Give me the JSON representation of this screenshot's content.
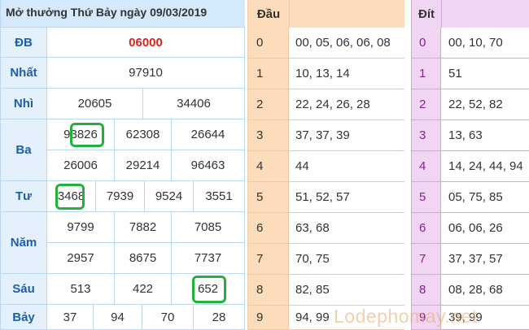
{
  "results": {
    "title": "Mở thưởng Thứ Bảy ngày 09/03/2019",
    "labels": {
      "db": "ĐB",
      "nhat": "Nhất",
      "nhi": "Nhì",
      "ba": "Ba",
      "tu": "Tư",
      "nam": "Năm",
      "sau": "Sáu",
      "bay": "Bảy"
    },
    "db": "06000",
    "nhat": "97910",
    "nhi": [
      "20605",
      "34406"
    ],
    "ba": [
      "93826",
      "62308",
      "26644",
      "26006",
      "29214",
      "96463"
    ],
    "tu": [
      "3468",
      "7939",
      "9524",
      "3551"
    ],
    "nam": [
      "9799",
      "7882",
      "7085",
      "2957",
      "8675",
      "7737"
    ],
    "sau": [
      "513",
      "422",
      "652"
    ],
    "bay": [
      "37",
      "94",
      "70",
      "28"
    ]
  },
  "dau": {
    "header": "Đầu",
    "rows": [
      {
        "key": "0",
        "values": "00, 05, 06, 06, 08"
      },
      {
        "key": "1",
        "values": "10, 13, 14"
      },
      {
        "key": "2",
        "values": "22, 24, 26, 28"
      },
      {
        "key": "3",
        "values": "37, 37, 39"
      },
      {
        "key": "4",
        "values": "44"
      },
      {
        "key": "5",
        "values": "51, 52, 57"
      },
      {
        "key": "6",
        "values": "63, 68"
      },
      {
        "key": "7",
        "values": "70, 75"
      },
      {
        "key": "8",
        "values": "82, 85"
      },
      {
        "key": "9",
        "values": "94, 99"
      }
    ]
  },
  "dit": {
    "header": "Đít",
    "rows": [
      {
        "key": "0",
        "values": "00, 10, 70"
      },
      {
        "key": "1",
        "values": "51"
      },
      {
        "key": "2",
        "values": "22, 52, 82"
      },
      {
        "key": "3",
        "values": "13, 63"
      },
      {
        "key": "4",
        "values": "14, 24, 44, 94"
      },
      {
        "key": "5",
        "values": "05, 75, 85"
      },
      {
        "key": "6",
        "values": "06, 06, 26"
      },
      {
        "key": "7",
        "values": "37, 37, 57"
      },
      {
        "key": "8",
        "values": "08, 28, 68"
      },
      {
        "key": "9",
        "values": "39, 99"
      }
    ]
  },
  "watermark": "Lodephomay.net",
  "colors": {
    "special_prize": "#e0201c",
    "highlight": "#22b13c"
  }
}
